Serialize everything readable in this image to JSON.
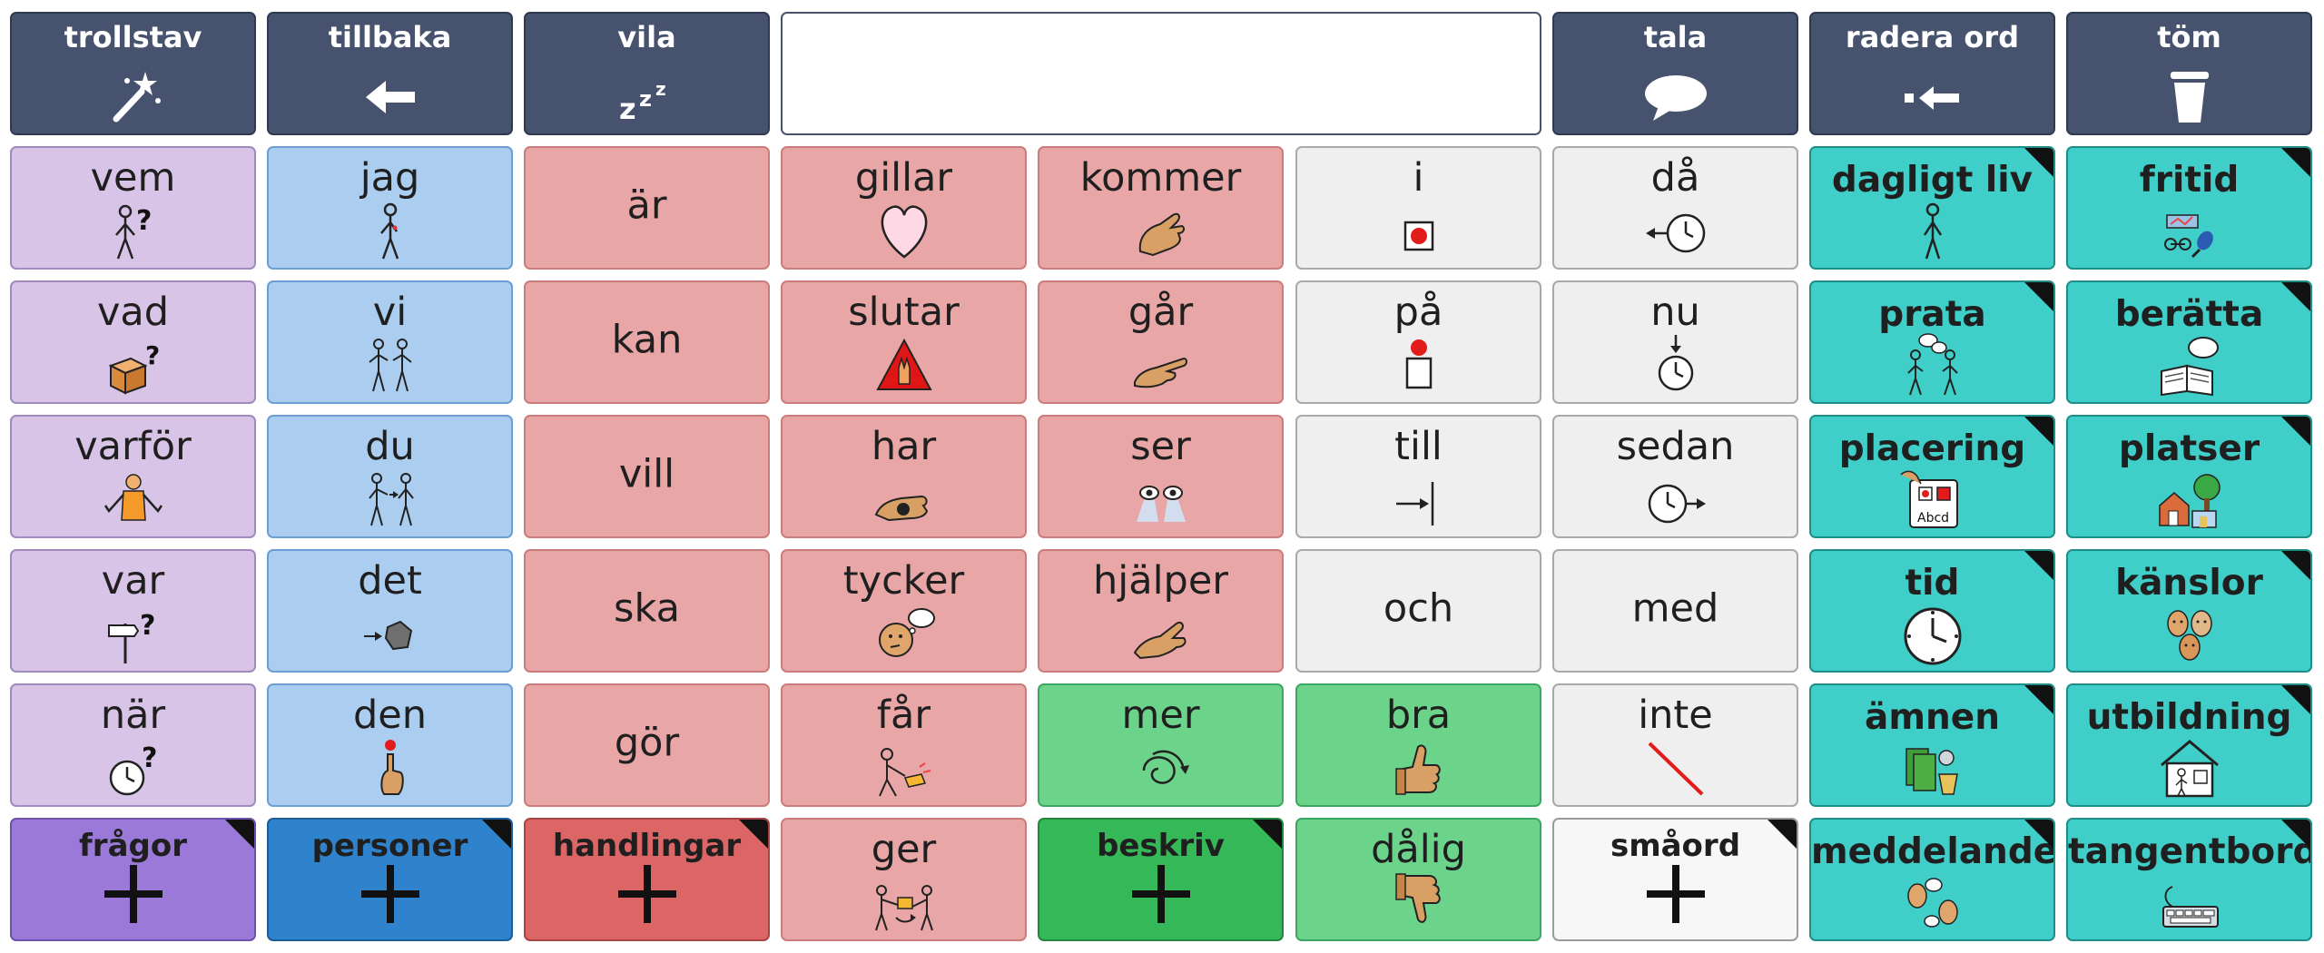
{
  "toolbar": {
    "wand_label": "trollstav",
    "back_label": "tillbaka",
    "sleep_label": "vila",
    "speak_label": "tala",
    "delete_word_label": "radera ord",
    "clear_label": "töm",
    "message_text": ""
  },
  "grid": {
    "c1": {
      "r1": "vem",
      "r2": "vad",
      "r3": "varför",
      "r4": "var",
      "r5": "när",
      "r6": "frågor"
    },
    "c2": {
      "r1": "jag",
      "r2": "vi",
      "r3": "du",
      "r4": "det",
      "r5": "den",
      "r6": "personer"
    },
    "c3": {
      "r1": "är",
      "r2": "kan",
      "r3": "vill",
      "r4": "ska",
      "r5": "gör",
      "r6": "handlingar"
    },
    "c4": {
      "r1": "gillar",
      "r2": "slutar",
      "r3": "har",
      "r4": "tycker",
      "r5": "får",
      "r6": "ger"
    },
    "c5": {
      "r1": "kommer",
      "r2": "går",
      "r3": "ser",
      "r4": "hjälper",
      "r5": "mer",
      "r6": "beskriv"
    },
    "c6": {
      "r1": "i",
      "r2": "på",
      "r3": "till",
      "r4": "och",
      "r5": "bra",
      "r6": "dålig"
    },
    "c7": {
      "r1": "då",
      "r2": "nu",
      "r3": "sedan",
      "r4": "med",
      "r5": "inte",
      "r6": "småord"
    },
    "c8": {
      "r1": "dagligt liv",
      "r2": "prata",
      "r3": "placering",
      "r4": "tid",
      "r5": "ämnen",
      "r6": "meddelanden"
    },
    "c9": {
      "r1": "fritid",
      "r2": "berätta",
      "r3": "platser",
      "r4": "känslor",
      "r5": "utbildning",
      "r6": "tangentbord"
    }
  },
  "icon_text": {
    "abcd": "Abcd"
  },
  "colors": {
    "toolbar": "#46526e",
    "question_words": "#d8c4e7",
    "pronouns": "#abcdef",
    "verbs": "#e9a6a6",
    "small_words": "#efefef",
    "describing_words": "#6cd48a",
    "categories": "#40cfc8"
  }
}
